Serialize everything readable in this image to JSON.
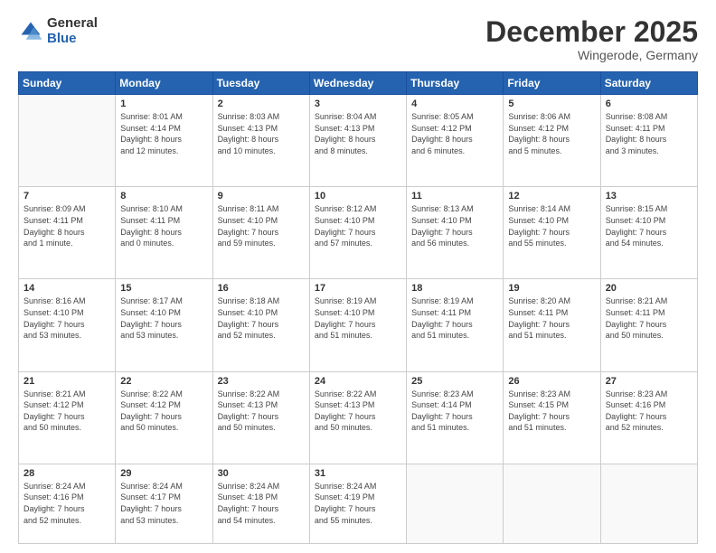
{
  "logo": {
    "general": "General",
    "blue": "Blue"
  },
  "header": {
    "month": "December 2025",
    "location": "Wingerode, Germany"
  },
  "weekdays": [
    "Sunday",
    "Monday",
    "Tuesday",
    "Wednesday",
    "Thursday",
    "Friday",
    "Saturday"
  ],
  "weeks": [
    [
      {
        "day": "",
        "info": ""
      },
      {
        "day": "1",
        "info": "Sunrise: 8:01 AM\nSunset: 4:14 PM\nDaylight: 8 hours\nand 12 minutes."
      },
      {
        "day": "2",
        "info": "Sunrise: 8:03 AM\nSunset: 4:13 PM\nDaylight: 8 hours\nand 10 minutes."
      },
      {
        "day": "3",
        "info": "Sunrise: 8:04 AM\nSunset: 4:13 PM\nDaylight: 8 hours\nand 8 minutes."
      },
      {
        "day": "4",
        "info": "Sunrise: 8:05 AM\nSunset: 4:12 PM\nDaylight: 8 hours\nand 6 minutes."
      },
      {
        "day": "5",
        "info": "Sunrise: 8:06 AM\nSunset: 4:12 PM\nDaylight: 8 hours\nand 5 minutes."
      },
      {
        "day": "6",
        "info": "Sunrise: 8:08 AM\nSunset: 4:11 PM\nDaylight: 8 hours\nand 3 minutes."
      }
    ],
    [
      {
        "day": "7",
        "info": "Sunrise: 8:09 AM\nSunset: 4:11 PM\nDaylight: 8 hours\nand 1 minute."
      },
      {
        "day": "8",
        "info": "Sunrise: 8:10 AM\nSunset: 4:11 PM\nDaylight: 8 hours\nand 0 minutes."
      },
      {
        "day": "9",
        "info": "Sunrise: 8:11 AM\nSunset: 4:10 PM\nDaylight: 7 hours\nand 59 minutes."
      },
      {
        "day": "10",
        "info": "Sunrise: 8:12 AM\nSunset: 4:10 PM\nDaylight: 7 hours\nand 57 minutes."
      },
      {
        "day": "11",
        "info": "Sunrise: 8:13 AM\nSunset: 4:10 PM\nDaylight: 7 hours\nand 56 minutes."
      },
      {
        "day": "12",
        "info": "Sunrise: 8:14 AM\nSunset: 4:10 PM\nDaylight: 7 hours\nand 55 minutes."
      },
      {
        "day": "13",
        "info": "Sunrise: 8:15 AM\nSunset: 4:10 PM\nDaylight: 7 hours\nand 54 minutes."
      }
    ],
    [
      {
        "day": "14",
        "info": "Sunrise: 8:16 AM\nSunset: 4:10 PM\nDaylight: 7 hours\nand 53 minutes."
      },
      {
        "day": "15",
        "info": "Sunrise: 8:17 AM\nSunset: 4:10 PM\nDaylight: 7 hours\nand 53 minutes."
      },
      {
        "day": "16",
        "info": "Sunrise: 8:18 AM\nSunset: 4:10 PM\nDaylight: 7 hours\nand 52 minutes."
      },
      {
        "day": "17",
        "info": "Sunrise: 8:19 AM\nSunset: 4:10 PM\nDaylight: 7 hours\nand 51 minutes."
      },
      {
        "day": "18",
        "info": "Sunrise: 8:19 AM\nSunset: 4:11 PM\nDaylight: 7 hours\nand 51 minutes."
      },
      {
        "day": "19",
        "info": "Sunrise: 8:20 AM\nSunset: 4:11 PM\nDaylight: 7 hours\nand 51 minutes."
      },
      {
        "day": "20",
        "info": "Sunrise: 8:21 AM\nSunset: 4:11 PM\nDaylight: 7 hours\nand 50 minutes."
      }
    ],
    [
      {
        "day": "21",
        "info": "Sunrise: 8:21 AM\nSunset: 4:12 PM\nDaylight: 7 hours\nand 50 minutes."
      },
      {
        "day": "22",
        "info": "Sunrise: 8:22 AM\nSunset: 4:12 PM\nDaylight: 7 hours\nand 50 minutes."
      },
      {
        "day": "23",
        "info": "Sunrise: 8:22 AM\nSunset: 4:13 PM\nDaylight: 7 hours\nand 50 minutes."
      },
      {
        "day": "24",
        "info": "Sunrise: 8:22 AM\nSunset: 4:13 PM\nDaylight: 7 hours\nand 50 minutes."
      },
      {
        "day": "25",
        "info": "Sunrise: 8:23 AM\nSunset: 4:14 PM\nDaylight: 7 hours\nand 51 minutes."
      },
      {
        "day": "26",
        "info": "Sunrise: 8:23 AM\nSunset: 4:15 PM\nDaylight: 7 hours\nand 51 minutes."
      },
      {
        "day": "27",
        "info": "Sunrise: 8:23 AM\nSunset: 4:16 PM\nDaylight: 7 hours\nand 52 minutes."
      }
    ],
    [
      {
        "day": "28",
        "info": "Sunrise: 8:24 AM\nSunset: 4:16 PM\nDaylight: 7 hours\nand 52 minutes."
      },
      {
        "day": "29",
        "info": "Sunrise: 8:24 AM\nSunset: 4:17 PM\nDaylight: 7 hours\nand 53 minutes."
      },
      {
        "day": "30",
        "info": "Sunrise: 8:24 AM\nSunset: 4:18 PM\nDaylight: 7 hours\nand 54 minutes."
      },
      {
        "day": "31",
        "info": "Sunrise: 8:24 AM\nSunset: 4:19 PM\nDaylight: 7 hours\nand 55 minutes."
      },
      {
        "day": "",
        "info": ""
      },
      {
        "day": "",
        "info": ""
      },
      {
        "day": "",
        "info": ""
      }
    ]
  ]
}
